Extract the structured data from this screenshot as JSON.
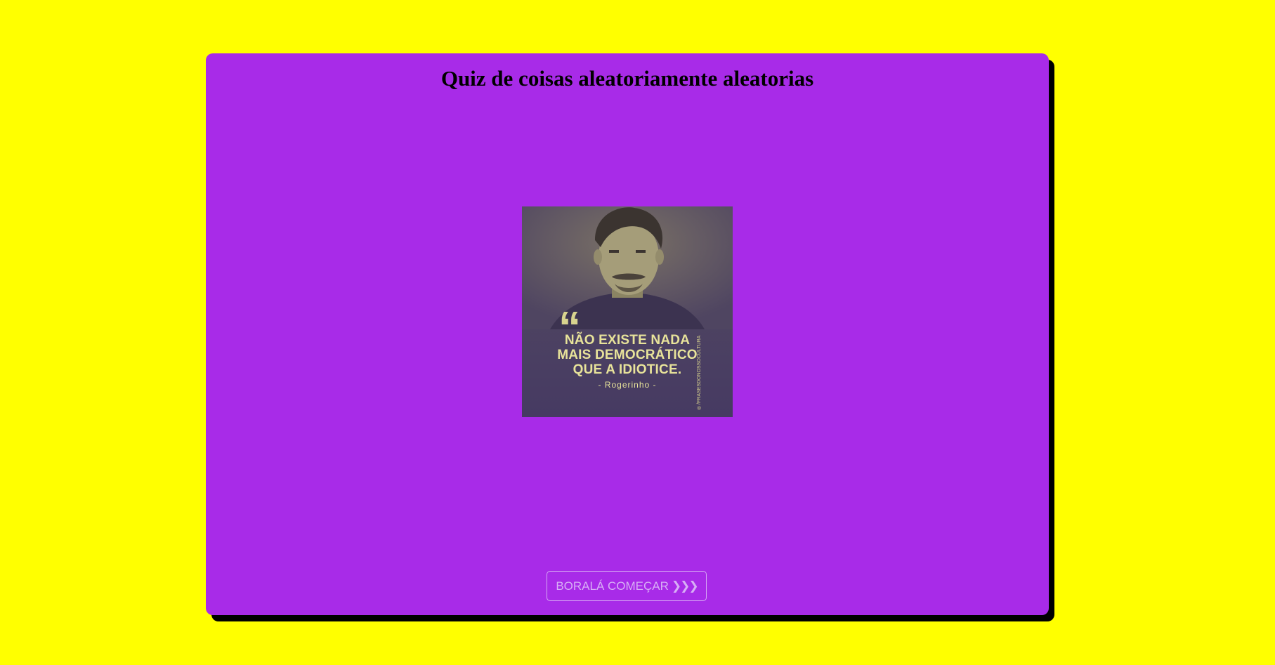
{
  "quiz": {
    "title": "Quiz de coisas aleatoriamente aleatorias",
    "image": {
      "quote_mark": "“",
      "quote_lines": [
        "NÃO EXISTE NADA",
        "MAIS DEMOCRÁTICO",
        "QUE A IDIOTICE."
      ],
      "author": "- Rogerinho -",
      "handle": "◎ /FRASESDONOSSOCULTURA"
    },
    "start_button": {
      "label": "BORALÁ COMEÇAR",
      "icon": "triple-chevron-right-icon",
      "icon_glyph": "❯❯❯"
    }
  },
  "colors": {
    "page_background": "#ffff00",
    "card_background": "#a82be8",
    "card_shadow": "#000000",
    "button_text": "#d7aef5",
    "poster_text": "#e8e39a"
  }
}
